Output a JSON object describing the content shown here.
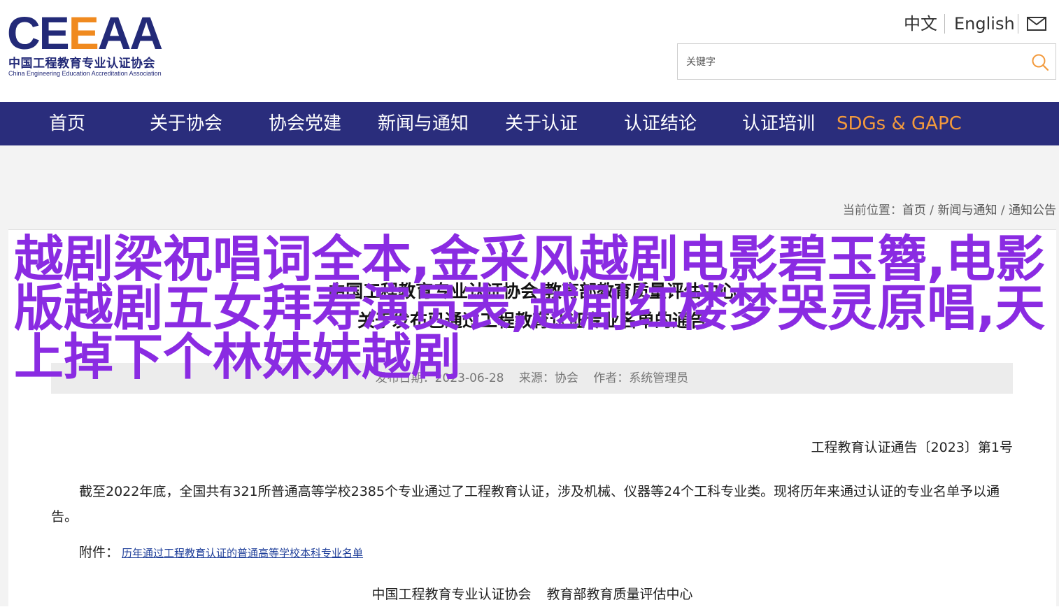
{
  "header": {
    "logo_mark_left": "CE",
    "logo_mark_mid": "E",
    "logo_mark_right": "AA",
    "logo_cn": "中国工程教育专业认证协会",
    "logo_en": "China Engineering Education Accreditation Association",
    "lang_cn": "中文",
    "lang_en": "English",
    "search_placeholder": "关键字"
  },
  "nav": {
    "items": [
      "首页",
      "关于协会",
      "协会党建",
      "新闻与通知",
      "关于认证",
      "认证结论",
      "认证培训",
      "SDGs & GAPC"
    ]
  },
  "breadcrumb": {
    "prefix": "当前位置：",
    "items": [
      "首页",
      "新闻与通知",
      "通知公告"
    ],
    "sep": " / "
  },
  "article": {
    "title_line1": "中国工程教育专业认证协会 教育部教育质量评估中心",
    "title_line2": "关于发布已通过工程教育认证专业名单的通告",
    "meta_date": "发布日期：2023-06-28",
    "meta_source": "来源：协会",
    "meta_author": "作者：系统管理员",
    "doc_number": "工程教育认证通告〔2023〕第1号",
    "paragraph": "截至2022年底，全国共有321所普通高等学校2385个专业通过了工程教育认证，涉及机械、仪器等24个工科专业类。现将历年来通过认证的专业名单予以通告。",
    "attach_label": "附件：",
    "attach_link": "历年通过工程教育认证的普通高等学校本科专业名单",
    "sign_org1": "中国工程教育专业认证协会",
    "sign_org2": "教育部教育质量评估中心"
  },
  "overlay": {
    "headline": "越剧梁祝唱词全本,金采风越剧电影碧玉簪,电影版越剧五女拜寿演员表,越剧红楼梦哭灵原唱,天上掉下个林妹妹越剧"
  },
  "colors": {
    "nav_bg": "#2a2d7c",
    "accent": "#f39a3c",
    "overlay": "#8a2be2"
  }
}
